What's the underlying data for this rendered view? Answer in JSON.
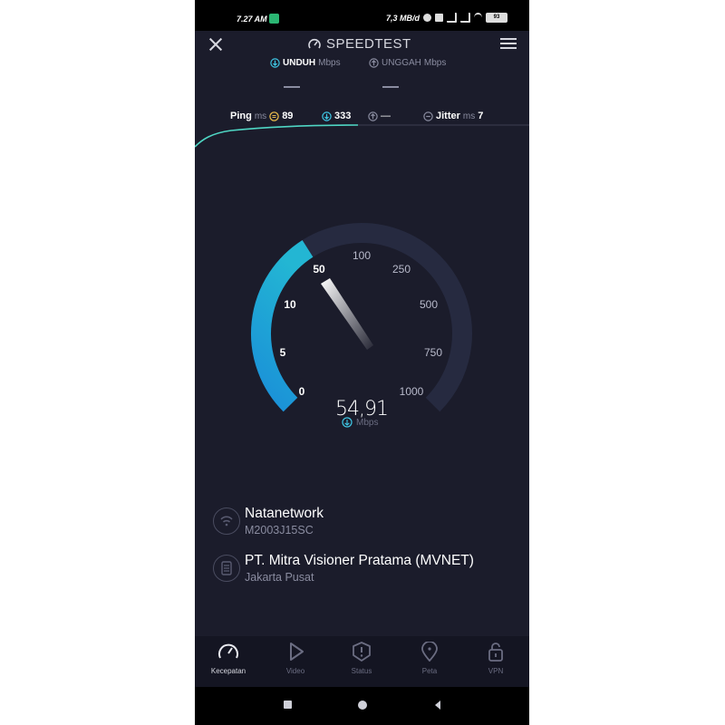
{
  "status_bar": {
    "time": "7.27 AM",
    "network_speed": "7,3 MB/d",
    "battery": "93"
  },
  "header": {
    "title": "SPEEDTEST"
  },
  "metric_tabs": [
    {
      "name": "UNDUH",
      "unit": "Mbps",
      "value": "—"
    },
    {
      "name": "UNGGAH",
      "unit": "Mbps",
      "value": "—"
    }
  ],
  "stats": {
    "ping_label": "Ping",
    "ping_unit": "ms",
    "ping_idle": "89",
    "ping_download": "333",
    "ping_upload": "—",
    "jitter_label": "Jitter",
    "jitter_unit": "ms",
    "jitter_value": "7"
  },
  "gauge": {
    "scale": [
      "0",
      "5",
      "10",
      "50",
      "100",
      "250",
      "500",
      "750",
      "1000"
    ],
    "value": "54,91",
    "unit": "Mbps",
    "fill_fraction": 0.38
  },
  "connection": {
    "network_name": "Natanetwork",
    "device": "M2003J15SC",
    "provider": "PT. Mitra Visioner Pratama (MVNET)",
    "location": "Jakarta Pusat"
  },
  "bottom_nav": [
    {
      "label": "Kecepatan",
      "icon": "speedometer-icon",
      "active": true
    },
    {
      "label": "Video",
      "icon": "play-icon",
      "active": false
    },
    {
      "label": "Status",
      "icon": "alert-icon",
      "active": false
    },
    {
      "label": "Peta",
      "icon": "map-pin-icon",
      "active": false
    },
    {
      "label": "VPN",
      "icon": "lock-icon",
      "active": false
    }
  ],
  "colors": {
    "background": "#1b1c2b",
    "accent": "#1fa6d6",
    "graph_line": "#4fd6c4",
    "nav_background": "#141522"
  }
}
